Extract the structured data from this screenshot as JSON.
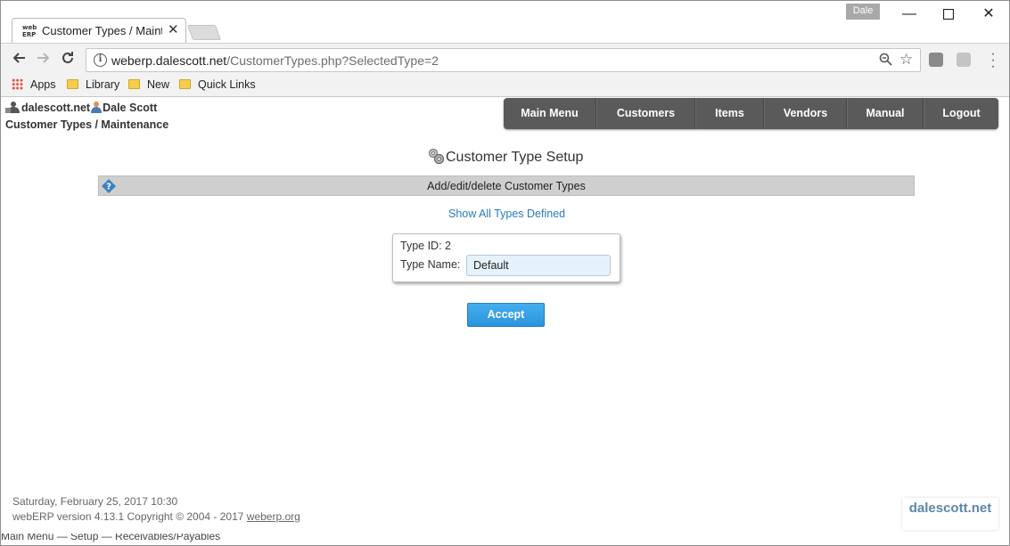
{
  "browser": {
    "tab_title": "Customer Types / Mainte",
    "tab_favicon": "web ERP",
    "profile_name": "Dale",
    "url_host": "weberp.dalescott.net",
    "url_path": "/CustomerTypes.php?SelectedType=2",
    "bookmarks": [
      "Apps",
      "Library",
      "New",
      "Quick Links"
    ]
  },
  "header": {
    "company": "dalescott.net",
    "user": "Dale Scott",
    "breadcrumb": "Customer Types / Maintenance"
  },
  "nav": {
    "items": [
      "Main Menu",
      "Customers",
      "Items",
      "Vendors",
      "Manual",
      "Logout"
    ]
  },
  "main": {
    "title": "Customer Type Setup",
    "help_text": "Add/edit/delete Customer Types",
    "show_all_link": "Show All Types Defined",
    "type_id_label": "Type ID: 2",
    "type_name_label": "Type Name:",
    "type_name_value": "Default",
    "accept_label": "Accept"
  },
  "footer": {
    "datetime": "Saturday, February 25, 2017 10:30",
    "copyright": "webERP version 4.13.1 Copyright © 2004 - 2017 ",
    "link": "weberp.org",
    "logo_text": "dalescott.net"
  },
  "background_text": "Main Menu — Setup — Receivables/Payables",
  "colors": {
    "nav_bg": "#5a5a5a",
    "accept_bg": "#3aa1e6",
    "link": "#2a7bbd",
    "help_bar": "#cfcfcf"
  }
}
